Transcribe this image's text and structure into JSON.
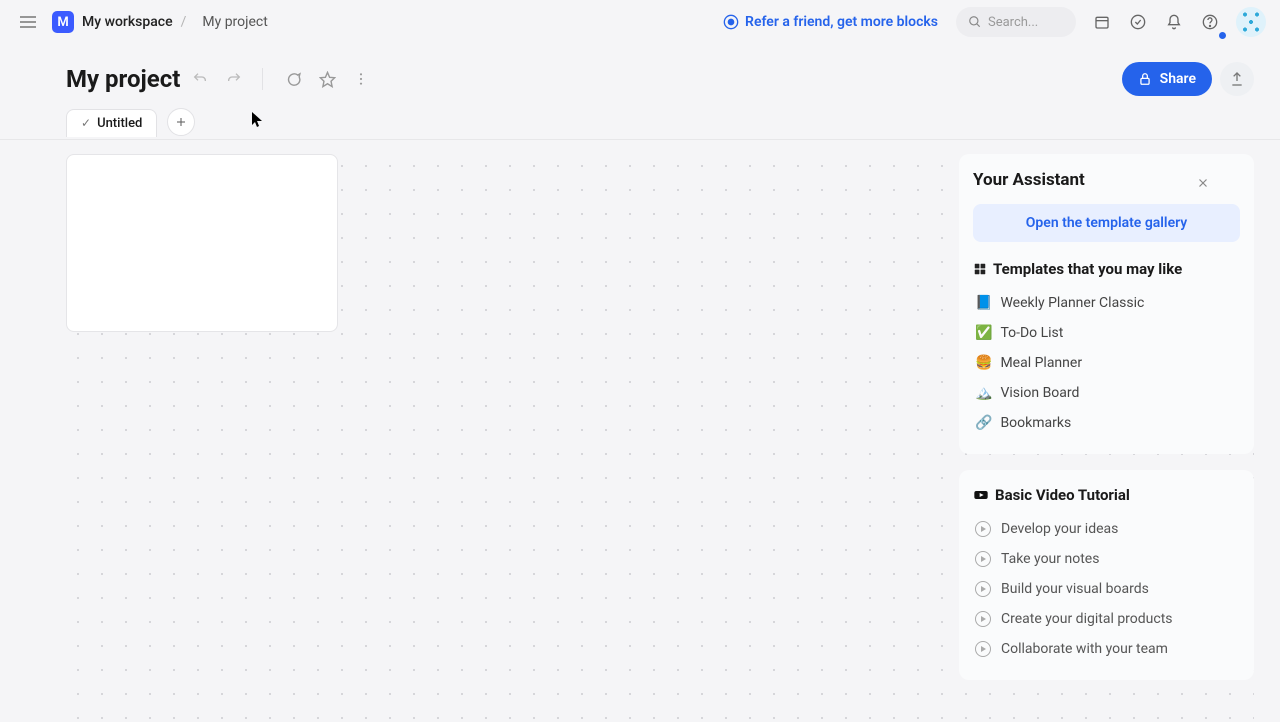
{
  "topbar": {
    "workspace_badge": "M",
    "workspace_name": "My workspace",
    "breadcrumb_current": "My project",
    "refer_text": "Refer a friend, get more blocks",
    "search_placeholder": "Search..."
  },
  "project": {
    "title": "My project",
    "share_label": "Share"
  },
  "tabs": {
    "items": [
      {
        "label": "Untitled",
        "completed": true
      }
    ]
  },
  "assistant": {
    "title": "Your Assistant",
    "open_gallery_label": "Open the template gallery",
    "templates_heading": "Templates that you may like",
    "templates": [
      {
        "icon": "📘",
        "label": "Weekly Planner Classic"
      },
      {
        "icon": "✅",
        "label": "To-Do List"
      },
      {
        "icon": "🍔",
        "label": "Meal Planner"
      },
      {
        "icon": "🏔️",
        "label": "Vision Board"
      },
      {
        "icon": "🔗",
        "label": "Bookmarks"
      }
    ],
    "video_heading": "Basic Video Tutorial",
    "videos": [
      {
        "label": "Develop your ideas"
      },
      {
        "label": "Take your notes"
      },
      {
        "label": "Build your visual boards"
      },
      {
        "label": "Create your digital products"
      },
      {
        "label": "Collaborate with your team"
      }
    ]
  }
}
